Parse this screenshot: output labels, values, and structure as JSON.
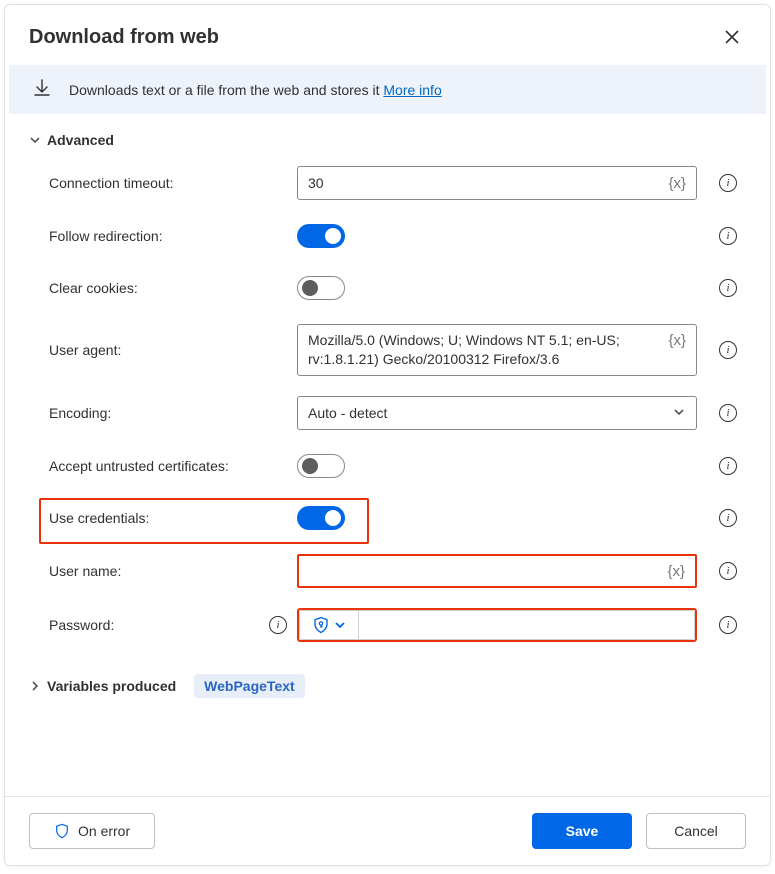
{
  "header": {
    "title": "Download from web"
  },
  "banner": {
    "text": "Downloads text or a file from the web and stores it ",
    "link": "More info"
  },
  "sections": {
    "advanced_label": "Advanced",
    "variables_label": "Variables produced",
    "variable_pill": "WebPageText"
  },
  "fields": {
    "connection_timeout": {
      "label": "Connection timeout:",
      "value": "30"
    },
    "follow_redirection": {
      "label": "Follow redirection:",
      "on": true
    },
    "clear_cookies": {
      "label": "Clear cookies:",
      "on": false
    },
    "user_agent": {
      "label": "User agent:",
      "value": "Mozilla/5.0 (Windows; U; Windows NT 5.1; en-US; rv:1.8.1.21) Gecko/20100312 Firefox/3.6"
    },
    "encoding": {
      "label": "Encoding:",
      "value": "Auto - detect"
    },
    "accept_untrusted": {
      "label": "Accept untrusted certificates:",
      "on": false
    },
    "use_credentials": {
      "label": "Use credentials:",
      "on": true
    },
    "user_name": {
      "label": "User name:",
      "value": ""
    },
    "password": {
      "label": "Password:",
      "value": ""
    }
  },
  "footer": {
    "on_error": "On error",
    "save": "Save",
    "cancel": "Cancel"
  },
  "glyphs": {
    "fx": "{x}"
  }
}
